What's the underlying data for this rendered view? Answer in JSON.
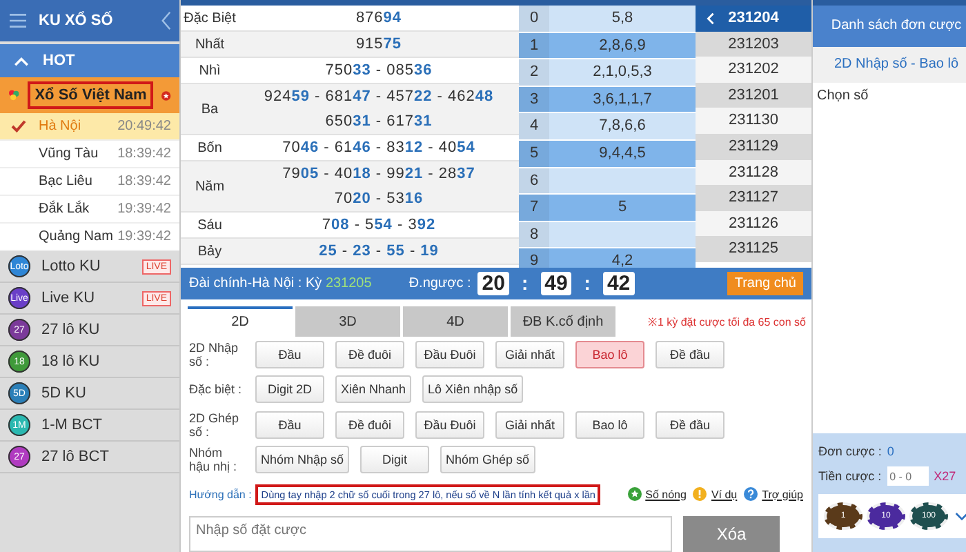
{
  "sidebar": {
    "title": "KU XỔ SỐ",
    "section": {
      "label": "HOT",
      "expanded": true
    },
    "group": {
      "label": "Xổ Số Việt Nam",
      "highlighted": true
    },
    "regions": [
      {
        "name": "Hà Nội",
        "time": "20:49:42",
        "selected": true
      },
      {
        "name": "Vũng Tàu",
        "time": "18:39:42",
        "selected": false
      },
      {
        "name": "Bạc Liêu",
        "time": "18:39:42",
        "selected": false
      },
      {
        "name": "Đắk Lắk",
        "time": "19:39:42",
        "selected": false
      },
      {
        "name": "Quảng Nam",
        "time": "19:39:42",
        "selected": false
      }
    ],
    "games": [
      {
        "badge": "Loto",
        "name": "Lotto KU",
        "color": "#2e86d6",
        "tag": "LIVE"
      },
      {
        "badge": "Live",
        "name": "Live KU",
        "color": "#6a3fc8",
        "tag": "LIVE"
      },
      {
        "badge": "27",
        "name": "27 lô KU",
        "color": "#7b3a9a"
      },
      {
        "badge": "18",
        "name": "18 lô KU",
        "color": "#3f9a3a"
      },
      {
        "badge": "5D",
        "name": "5D KU",
        "color": "#2a7fb8"
      },
      {
        "badge": "1M",
        "name": "1-M BCT",
        "color": "#2ab8b0"
      },
      {
        "badge": "27",
        "name": "27 lô BCT",
        "color": "#b03ac0"
      }
    ]
  },
  "results": [
    {
      "prize": "Đặc Biệt",
      "lines": [
        "876**94**"
      ]
    },
    {
      "prize": "Nhất",
      "lines": [
        "915**75**"
      ]
    },
    {
      "prize": "Nhì",
      "lines": [
        "750**33** - 085**36**"
      ]
    },
    {
      "prize": "Ba",
      "lines": [
        "924**59** - 681**47** - 457**22** - 462**48**",
        "650**31** - 617**31**"
      ]
    },
    {
      "prize": "Bốn",
      "lines": [
        "70**46** - 61**46** - 83**12** - 40**54**"
      ]
    },
    {
      "prize": "Năm",
      "lines": [
        "79**05** - 40**18** - 99**21** - 28**37**",
        "70**20** - 53**16**"
      ]
    },
    {
      "prize": "Sáu",
      "lines": [
        "7**08** - 5**54** - 3**92**"
      ]
    },
    {
      "prize": "Bảy",
      "lines": [
        "**25** - **23** - **55** - **19**"
      ]
    }
  ],
  "digits": [
    {
      "digit": "0",
      "values": "5,8"
    },
    {
      "digit": "1",
      "values": "2,8,6,9"
    },
    {
      "digit": "2",
      "values": "2,1,0,5,3"
    },
    {
      "digit": "3",
      "values": "3,6,1,1,7"
    },
    {
      "digit": "4",
      "values": "7,8,6,6"
    },
    {
      "digit": "5",
      "values": "9,4,4,5"
    },
    {
      "digit": "6"
    },
    {
      "digit": "7",
      "values": "5"
    },
    {
      "digit": "8"
    },
    {
      "digit": "9",
      "values": "4,2"
    }
  ],
  "periods": [
    {
      "label": "231204",
      "selected": true
    },
    {
      "label": "231203",
      "selected": false
    },
    {
      "label": "231202",
      "selected": false
    },
    {
      "label": "231201",
      "selected": false
    },
    {
      "label": "231130",
      "selected": false
    },
    {
      "label": "231129",
      "selected": false
    },
    {
      "label": "231128",
      "selected": false
    },
    {
      "label": "231127",
      "selected": false
    },
    {
      "label": "231126",
      "selected": false
    },
    {
      "label": "231125",
      "selected": false
    }
  ],
  "draw_bar": {
    "station": "Đài chính-Hà Nội : Kỳ",
    "period": "231205",
    "countdown_label": "Đ.ngược :",
    "countdown": [
      "20",
      "49",
      "42"
    ],
    "countdown_separator": ":",
    "home_button": "Trang chủ"
  },
  "tabs": [
    {
      "label": "2D",
      "selected": true
    },
    {
      "label": "3D",
      "selected": false
    },
    {
      "label": "4D",
      "selected": false
    },
    {
      "label": "ĐB K.cố định",
      "selected": false
    }
  ],
  "limit_note": "※1 kỳ đặt cược tối đa 65 con số",
  "bet_rows": [
    {
      "label": "2D Nhập số :",
      "options": [
        {
          "label": "Đầu",
          "selected": false
        },
        {
          "label": "Đề đuôi",
          "selected": false
        },
        {
          "label": "Đầu Đuôi",
          "selected": false
        },
        {
          "label": "Giải nhất",
          "selected": false
        },
        {
          "label": "Bao lô",
          "selected": true
        },
        {
          "label": "Đề đầu",
          "selected": false
        }
      ]
    },
    {
      "label": "Đặc biệt :",
      "options": [
        {
          "label": "Digit 2D",
          "selected": false
        },
        {
          "label": "Xiên Nhanh",
          "selected": false
        },
        {
          "label": "Lô Xiên nhập số",
          "selected": false
        }
      ]
    },
    {
      "label": "2D Ghép số :",
      "options": [
        {
          "label": "Đầu",
          "selected": false
        },
        {
          "label": "Đề đuôi",
          "selected": false
        },
        {
          "label": "Đầu Đuôi",
          "selected": false
        },
        {
          "label": "Giải nhất",
          "selected": false
        },
        {
          "label": "Bao lô",
          "selected": false
        },
        {
          "label": "Đề đầu",
          "selected": false
        }
      ]
    },
    {
      "label": "Nhóm hậu nhị :",
      "options": [
        {
          "label": "Nhóm Nhập số",
          "selected": false
        },
        {
          "label": "Digit",
          "selected": false
        },
        {
          "label": "Nhóm Ghép số",
          "selected": false
        }
      ]
    }
  ],
  "guide": {
    "label": "Hướng dẫn :",
    "text": "Dùng tay nhập 2 chữ số cuối trong 27 lô, nếu số về N lần tính kết quả x lần",
    "highlighted": true,
    "links": [
      {
        "kind": "hot",
        "label": "Số nóng"
      },
      {
        "kind": "example",
        "label": "Ví dụ"
      },
      {
        "kind": "help",
        "label": "Trợ giúp"
      }
    ]
  },
  "entry": {
    "placeholder": "Nhập số đặt cược",
    "clear_button": "Xóa"
  },
  "bet_panel": {
    "title": "Danh sách đơn cược",
    "bet_type": "2D Nhập số - Bao lô",
    "pick_label": "Chọn số",
    "order_label": "Đơn cược :",
    "order_count": "0",
    "amount_label": "Tiền cược :",
    "amount_placeholder": "0 - 0",
    "multiplier": "X27",
    "chips": [
      {
        "value": "1",
        "color": "#5a3a1a"
      },
      {
        "value": "10",
        "color": "#4b2a9e"
      },
      {
        "value": "100",
        "color": "#1f4f4f"
      }
    ]
  }
}
